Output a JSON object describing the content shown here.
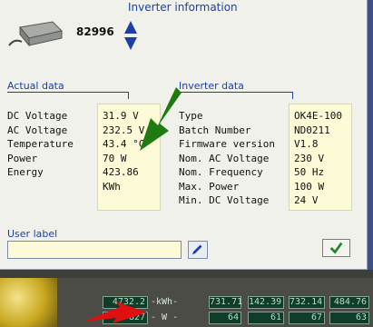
{
  "header": {
    "title": "Inverter information",
    "serial": "82996"
  },
  "actual": {
    "heading": "Actual data",
    "labels": [
      "DC Voltage",
      "AC Voltage",
      "Temperature",
      "Power",
      "Energy"
    ],
    "values": [
      "31.9 V",
      "232.5 V",
      "43.4 °C",
      "70 W",
      "423.86 KWh"
    ]
  },
  "inverter": {
    "heading": "Inverter data",
    "labels": [
      "Type",
      "Batch Number",
      "Firmware version",
      "Nom. AC Voltage",
      "Nom. Frequency",
      "Max. Power",
      "Min. DC Voltage"
    ],
    "values": [
      "OK4E-100",
      "ND0211",
      "V1.8",
      "230 V",
      "50 Hz",
      "100 W",
      "24 V"
    ]
  },
  "user_label": {
    "label": "User label",
    "value": ""
  },
  "icons": {
    "device": "inverter-device-icon",
    "arrows": "up-down-arrows-icon",
    "pen": "pencil-icon",
    "ok": "checkmark-icon"
  },
  "colors": {
    "accent": "#1b3fa6",
    "value_bg": "#fdfbd7",
    "green_arrow": "#1f7a0f",
    "red_arrow": "#e01010",
    "check": "#1e8a1e"
  },
  "background_panel": {
    "row1": [
      "4732.2",
      "-kWh-",
      "731.71",
      "142.39",
      "732.14",
      "484.76"
    ],
    "row2": [
      "827",
      "- W -",
      "64",
      "61",
      "67",
      "63"
    ]
  }
}
